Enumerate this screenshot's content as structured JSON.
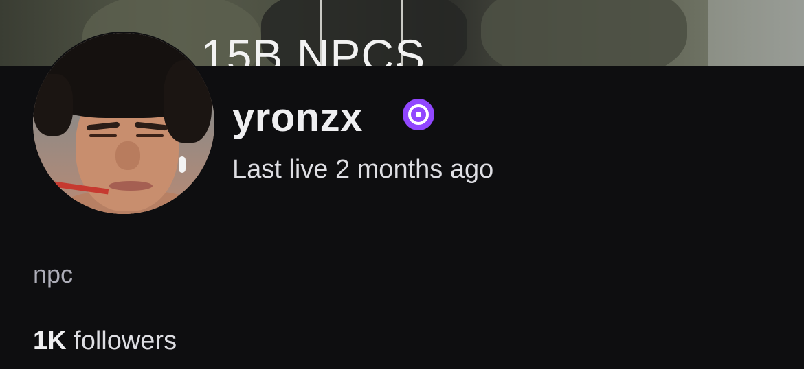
{
  "banner": {
    "overlay_text": "15B NPCS"
  },
  "profile": {
    "channel_name": "yronzx",
    "badge_icon": "music-disc-icon",
    "badge_color": "#9147ff",
    "last_live": "Last live 2 months ago",
    "bio": "npc",
    "followers_count": "1K",
    "followers_label": "followers"
  },
  "colors": {
    "background": "#0e0e10",
    "text_primary": "#efeff1",
    "text_secondary": "#adadb8"
  }
}
